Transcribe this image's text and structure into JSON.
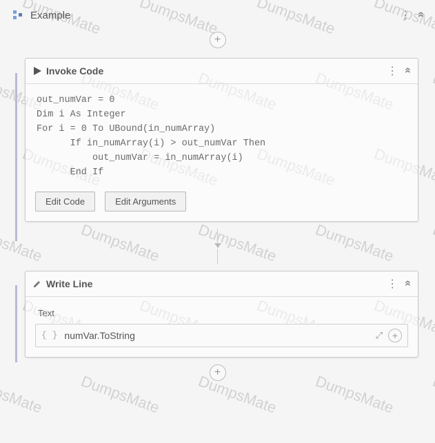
{
  "watermark": "DumpsMate",
  "sequence": {
    "title": "Example"
  },
  "invoke": {
    "title": "Invoke Code",
    "code": "out_numVar = 0\nDim i As Integer\nFor i = 0 To UBound(in_numArray)\n      If in_numArray(i) > out_numVar Then\n          out_numVar = in_numArray(i)\n      End If",
    "edit_code_label": "Edit Code",
    "edit_args_label": "Edit Arguments"
  },
  "writeline": {
    "title": "Write Line",
    "text_label": "Text",
    "expression": "numVar.ToString"
  }
}
